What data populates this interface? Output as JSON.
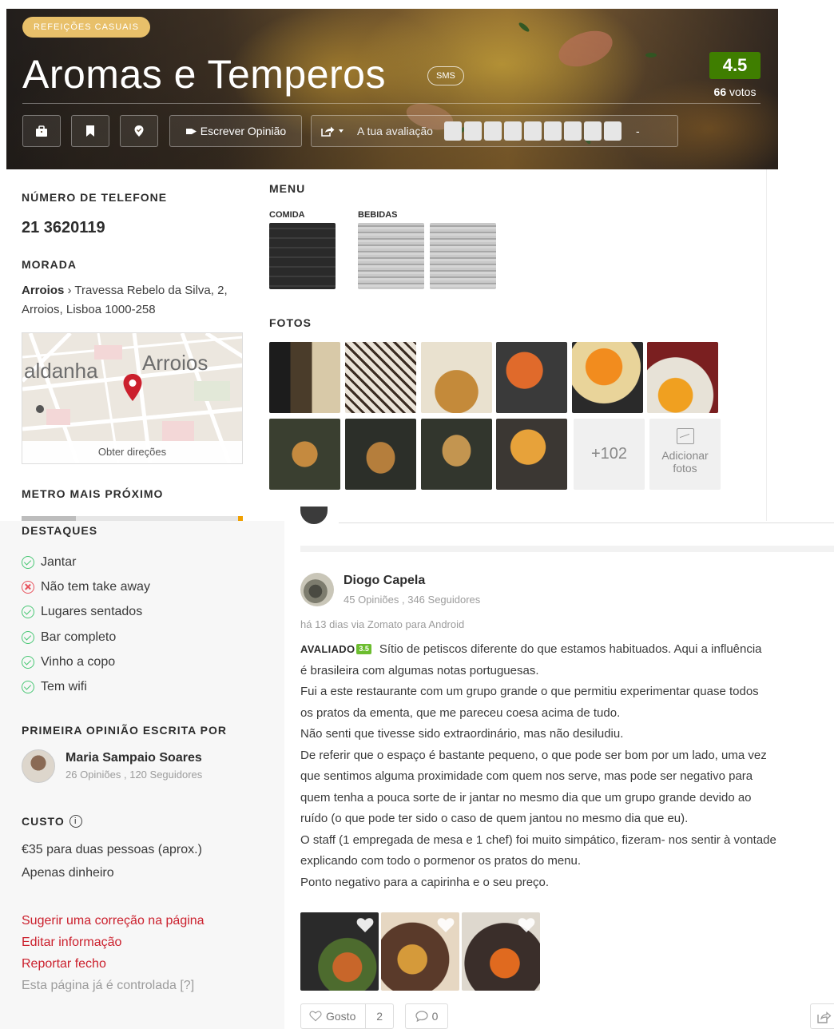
{
  "hero": {
    "category": "REFEIÇÕES CASUAIS",
    "name": "Aromas e Temperos",
    "sms": "SMS",
    "rating": "4.5",
    "votes_count": "66",
    "votes_label": "votos",
    "write_review": "Escrever Opinião",
    "your_rating": "A tua avaliação",
    "rating_dash": "-",
    "colors": {
      "rating_bg": "#3f7e00",
      "category_bg": "#e8c06a"
    }
  },
  "info": {
    "phone_label": "NÚMERO DE TELEFONE",
    "phone": "21 3620119",
    "address_label": "MORADA",
    "area": "Arroios",
    "address_line1": " › Travessa Rebelo da Silva, 2,",
    "address_line2": "Arroios, Lisboa 1000-258",
    "map_label_1": "aldanha",
    "map_label_2": "Arroios",
    "map_directions": "Obter direções",
    "metro_label": "METRO MAIS PRÓXIMO"
  },
  "highlights": {
    "label": "DESTAQUES",
    "items": [
      {
        "text": "Jantar",
        "ok": true
      },
      {
        "text": "Não tem take away",
        "ok": false
      },
      {
        "text": "Lugares sentados",
        "ok": true
      },
      {
        "text": "Bar completo",
        "ok": true
      },
      {
        "text": "Vinho a copo",
        "ok": true
      },
      {
        "text": "Tem wifi",
        "ok": true
      }
    ]
  },
  "first_review": {
    "label": "PRIMEIRA OPINIÃO ESCRITA POR",
    "name": "Maria Sampaio Soares",
    "meta": "26 Opiniões , 120 Seguidores"
  },
  "cost": {
    "label": "CUSTO",
    "info": "i",
    "price": "€35 para duas pessoas (aprox.)",
    "payment": "Apenas dinheiro"
  },
  "links": {
    "suggest": "Sugerir uma correção na página",
    "edit": "Editar informação",
    "report": "Reportar fecho",
    "controlled": "Esta página já é controlada [?]"
  },
  "menu": {
    "title": "MENU",
    "food": "COMIDA",
    "drinks": "BEBIDAS",
    "photos_title": "FOTOS",
    "more_photos": "+102",
    "add_photos_1": "Adicionar",
    "add_photos_2": "fotos"
  },
  "review": {
    "author": "Diogo Capela",
    "author_meta": "45 Opiniões , 346 Seguidores",
    "time": "há 13 dias via Zomato para Android",
    "rated_label": "AVALIADO",
    "rated_score": "3.5",
    "lines": [
      "Sítio de petiscos diferente do que estamos habituados. Aqui a influência",
      "é brasileira com algumas notas portuguesas.",
      "Fui a este restaurante com um grupo grande o que permitiu experimentar quase todos",
      "os pratos da ementa, que me pareceu coesa acima de tudo.",
      "Não senti que tivesse sido extraordinário, mas não desiludiu.",
      "De referir que o espaço é bastante pequeno, o que pode ser bom por um lado, uma vez",
      "que sentimos alguma proximidade com quem nos serve, mas pode ser negativo para",
      "quem tenha a pouca sorte de ir jantar no mesmo dia que um grupo grande devido ao",
      "ruído (o que pode ter sido o caso de quem jantou no mesmo dia que eu).",
      "O staff (1 empregada de mesa e 1 chef) foi muito simpático, fizeram- nos sentir à vontade",
      "explicando com todo o pormenor os pratos do menu.",
      "Ponto negativo para a capirinha e o seu preço."
    ],
    "like_label": "Gosto",
    "like_count": "2",
    "comment_count": "0"
  }
}
